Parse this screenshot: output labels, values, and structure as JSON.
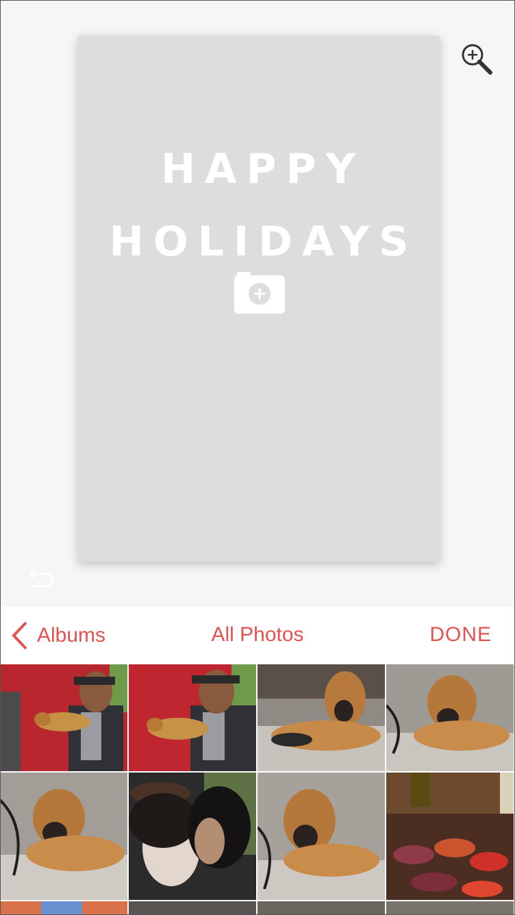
{
  "card": {
    "line1": "HAPPY",
    "line2": "HOLIDAYS",
    "add_photo_icon": "camera-plus-icon"
  },
  "toolbar": {
    "zoom_icon": "zoom-in-icon",
    "undo_icon": "undo-icon"
  },
  "picker": {
    "back_label": "Albums",
    "title": "All Photos",
    "done_label": "DONE"
  },
  "photos": [
    {
      "subject": "man holding bird"
    },
    {
      "subject": "man holding bird"
    },
    {
      "subject": "dog lying"
    },
    {
      "subject": "dog lying"
    },
    {
      "subject": "dog lying"
    },
    {
      "subject": "couple portrait"
    },
    {
      "subject": "dog lying"
    },
    {
      "subject": "kebab skewers"
    }
  ],
  "colors": {
    "accent": "#e4524f",
    "card": "#dddddd",
    "background": "#f5f6f8"
  }
}
